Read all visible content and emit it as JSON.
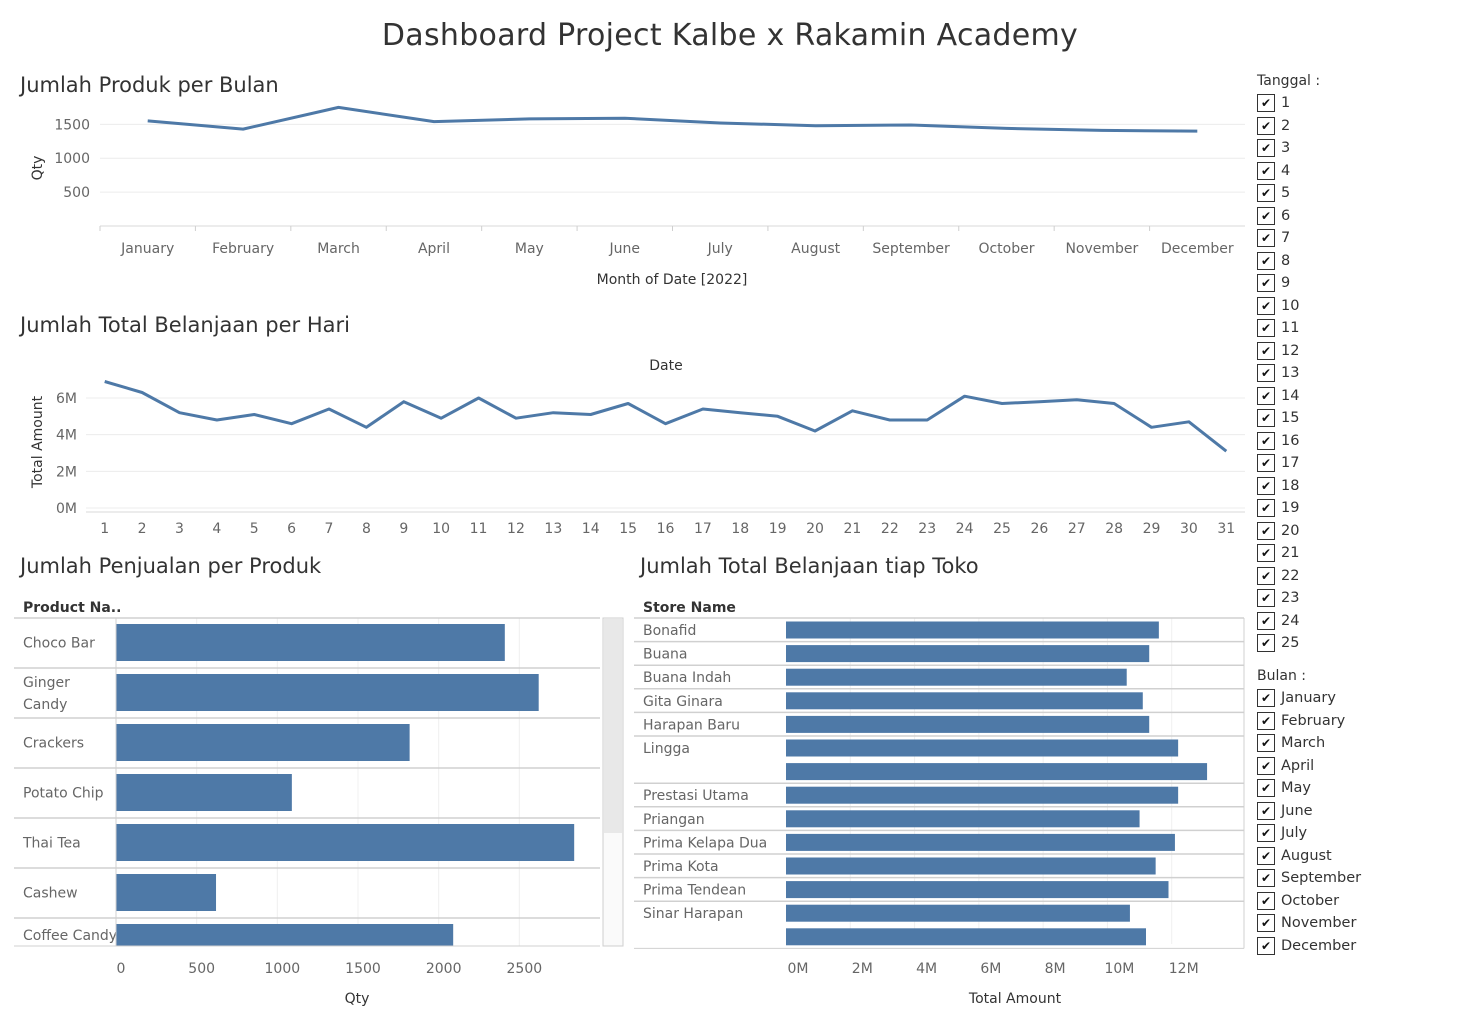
{
  "dashboard_title": "Dashboard Project Kalbe x Rakamin Academy",
  "filters": {
    "tanggal": {
      "title": "Tanggal :",
      "items": [
        "1",
        "2",
        "3",
        "4",
        "5",
        "6",
        "7",
        "8",
        "9",
        "10",
        "11",
        "12",
        "13",
        "14",
        "15",
        "16",
        "17",
        "18",
        "19",
        "20",
        "21",
        "22",
        "23",
        "24",
        "25"
      ],
      "checked": true
    },
    "bulan": {
      "title": "Bulan :",
      "items": [
        "January",
        "February",
        "March",
        "April",
        "May",
        "June",
        "July",
        "August",
        "September",
        "October",
        "November",
        "December"
      ],
      "checked": true
    }
  },
  "colors": {
    "bar": "#4e79a7",
    "line": "#4e79a7",
    "grid": "#ececec"
  },
  "chart_data": [
    {
      "id": "monthly",
      "type": "line",
      "title": "Jumlah Produk per Bulan",
      "xlabel": "Month of Date [2022]",
      "ylabel": "Qty",
      "categories": [
        "January",
        "February",
        "March",
        "April",
        "May",
        "June",
        "July",
        "August",
        "September",
        "October",
        "November",
        "December"
      ],
      "values": [
        1550,
        1430,
        1750,
        1540,
        1580,
        1590,
        1520,
        1480,
        1490,
        1440,
        1410,
        1400
      ],
      "yticks": [
        500,
        1000,
        1500
      ],
      "ylim": [
        0,
        1800
      ]
    },
    {
      "id": "daily",
      "type": "line",
      "title": "Jumlah Total Belanjaan per Hari",
      "xlabel": "Date",
      "ylabel": "Total Amount",
      "categories": [
        "1",
        "2",
        "3",
        "4",
        "5",
        "6",
        "7",
        "8",
        "9",
        "10",
        "11",
        "12",
        "13",
        "14",
        "15",
        "16",
        "17",
        "18",
        "19",
        "20",
        "21",
        "22",
        "23",
        "24",
        "25",
        "26",
        "27",
        "28",
        "29",
        "30",
        "31"
      ],
      "values": [
        6.9,
        6.3,
        5.2,
        4.8,
        5.1,
        4.6,
        5.4,
        4.4,
        5.8,
        4.9,
        6.0,
        4.9,
        5.2,
        5.1,
        5.7,
        4.6,
        5.4,
        5.2,
        5.0,
        4.2,
        5.3,
        4.8,
        4.8,
        6.1,
        5.7,
        5.8,
        5.9,
        5.7,
        4.4,
        4.7,
        3.1
      ],
      "unit": "M",
      "yticks": [
        "0M",
        "2M",
        "4M",
        "6M"
      ],
      "ylim": [
        0,
        7.2
      ]
    },
    {
      "id": "products",
      "type": "bar",
      "orientation": "horizontal",
      "title": "Jumlah Penjualan per Produk",
      "column_header": "Product Na..",
      "xlabel": "Qty",
      "categories": [
        "Choco Bar",
        "Ginger Candy",
        "Crackers",
        "Potato Chip",
        "Thai Tea",
        "Cashew",
        "Coffee Candy"
      ],
      "values": [
        2410,
        2620,
        1820,
        1090,
        2840,
        620,
        2090
      ],
      "xticks": [
        0,
        500,
        1000,
        1500,
        2000,
        2500
      ],
      "xlim": [
        0,
        3000
      ]
    },
    {
      "id": "stores",
      "type": "bar",
      "orientation": "horizontal",
      "title": "Jumlah Total Belanjaan tiap Toko",
      "column_header": "Store Name",
      "xlabel": "Total Amount",
      "stores": [
        {
          "name": "Bonafid",
          "values": [
            11.6
          ]
        },
        {
          "name": "Buana",
          "values": [
            11.3
          ]
        },
        {
          "name": "Buana Indah",
          "values": [
            10.6
          ]
        },
        {
          "name": "Gita Ginara",
          "values": [
            11.1
          ]
        },
        {
          "name": "Harapan Baru",
          "values": [
            11.3
          ]
        },
        {
          "name": "Lingga",
          "values": [
            12.2,
            13.1
          ]
        },
        {
          "name": "Prestasi Utama",
          "values": [
            12.2
          ]
        },
        {
          "name": "Priangan",
          "values": [
            11.0
          ]
        },
        {
          "name": "Prima Kelapa Dua",
          "values": [
            12.1
          ]
        },
        {
          "name": "Prima Kota",
          "values": [
            11.5
          ]
        },
        {
          "name": "Prima Tendean",
          "values": [
            11.9
          ]
        },
        {
          "name": "Sinar Harapan",
          "values": [
            10.7,
            11.2
          ]
        }
      ],
      "unit": "M",
      "xticks": [
        "0M",
        "2M",
        "4M",
        "6M",
        "8M",
        "10M",
        "12M"
      ],
      "xlim": [
        0,
        14
      ]
    }
  ]
}
